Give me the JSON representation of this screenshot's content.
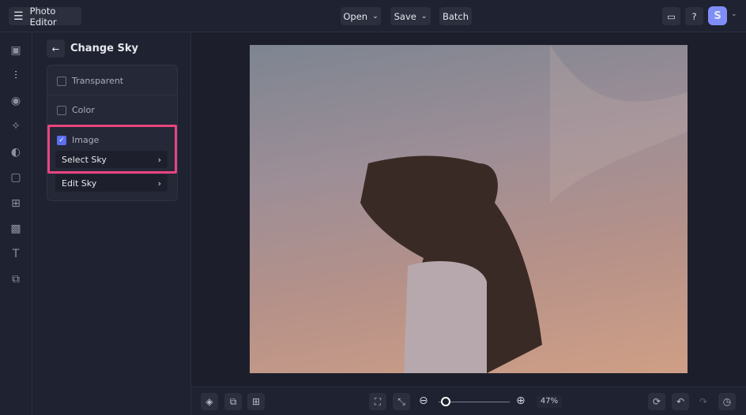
{
  "header": {
    "app_title": "Photo Editor",
    "open": "Open",
    "save": "Save",
    "batch": "Batch",
    "avatar": "S"
  },
  "panel": {
    "title": "Change Sky",
    "options": [
      {
        "label": "Transparent",
        "checked": false
      },
      {
        "label": "Color",
        "checked": false
      },
      {
        "label": "Image",
        "checked": true
      }
    ],
    "select_sky": "Select Sky",
    "edit_sky": "Edit Sky"
  },
  "footer": {
    "zoom": "47%",
    "zoom_value": 47
  },
  "colors": {
    "accent": "#5b6ef0",
    "highlight": "#e8457f"
  }
}
